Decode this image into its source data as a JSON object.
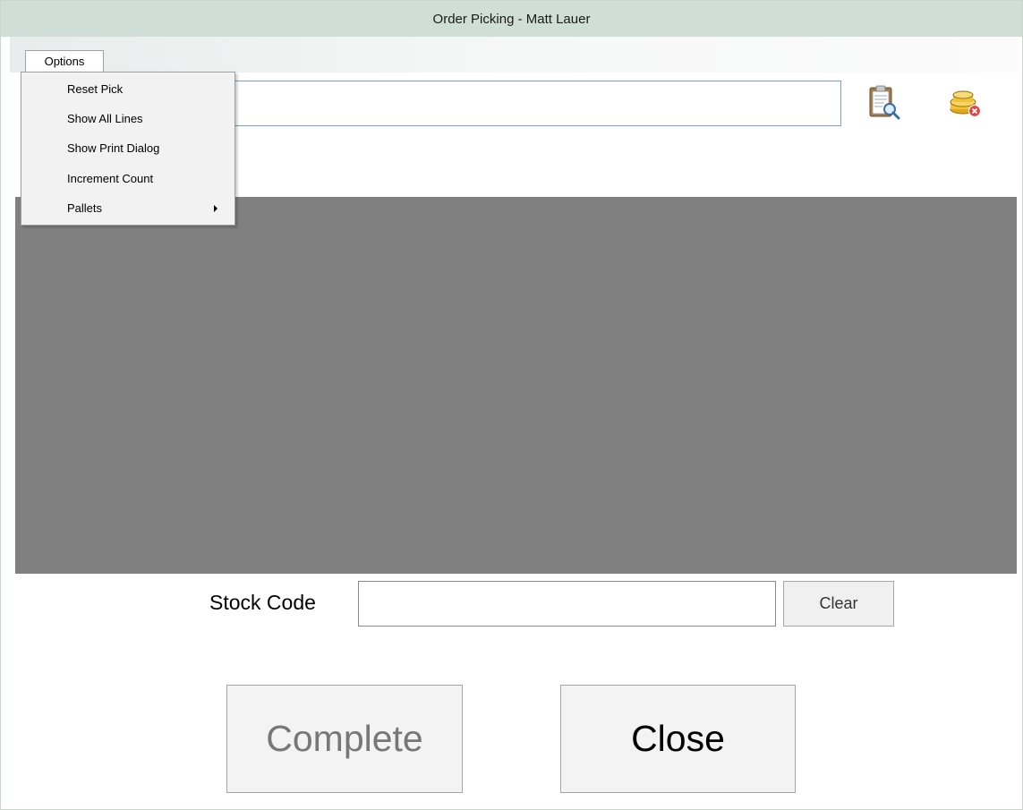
{
  "window": {
    "title": "Order Picking - Matt Lauer"
  },
  "menubar": {
    "options_label": "Options"
  },
  "options_menu": {
    "items": [
      {
        "label": "Reset Pick"
      },
      {
        "label": "Show All Lines"
      },
      {
        "label": "Show Print Dialog"
      },
      {
        "label": "Increment Count"
      },
      {
        "label": "Pallets",
        "has_submenu": true
      }
    ]
  },
  "order": {
    "value": ""
  },
  "toolbar": {
    "icons": [
      "clipboard-search-icon",
      "database-delete-icon"
    ]
  },
  "stock": {
    "label": "Stock Code",
    "value": "",
    "clear_label": "Clear"
  },
  "actions": {
    "complete_label": "Complete",
    "close_label": "Close"
  },
  "colors": {
    "titlebar": "#cfdfd8",
    "grid_background": "#808080",
    "disabled_text": "#777777"
  }
}
